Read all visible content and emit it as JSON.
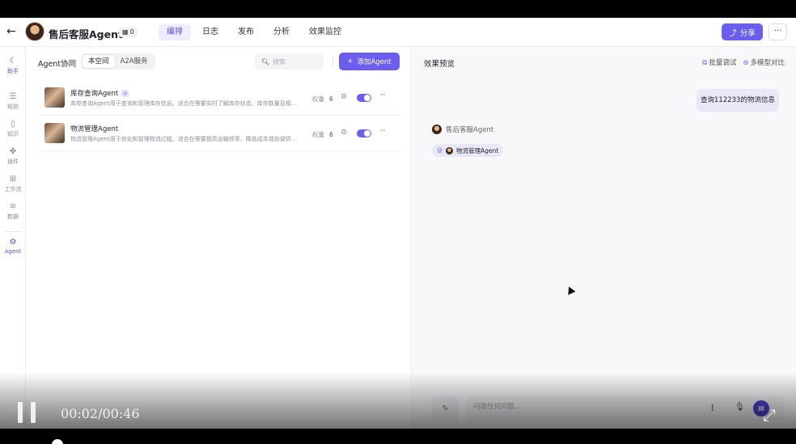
{
  "header": {
    "title": "售后客服Agent",
    "badge_count": "0",
    "tabs": [
      "编排",
      "日志",
      "发布",
      "分析",
      "效果监控"
    ],
    "active_tab": 0,
    "share_label": "分享",
    "more_label": "···"
  },
  "rail": [
    {
      "label": "助手",
      "icon": "assistant-icon"
    },
    {
      "label": "规则",
      "icon": "rules-icon"
    },
    {
      "label": "知识",
      "icon": "knowledge-icon"
    },
    {
      "label": "插件",
      "icon": "plugin-icon"
    },
    {
      "label": "工作流",
      "icon": "workflow-icon"
    },
    {
      "label": "数据",
      "icon": "database-icon"
    },
    {
      "label": "Agent",
      "icon": "agent-icon"
    }
  ],
  "middle": {
    "title": "Agent协同",
    "segments": [
      "本空间",
      "A2A服务"
    ],
    "search_placeholder": "搜索",
    "add_label": "添加Agent",
    "agents": [
      {
        "name": "库存查询Agent",
        "desc": "库存查询Agent用于查询和管理库存信息。适合在需要实时了解库存状态、库存数量及相...",
        "weight_label": "权重",
        "weight": "6",
        "enabled": true
      },
      {
        "name": "物流管理Agent",
        "desc": "物流管理Agent用于优化和管理物流过程。适合在需要提高运输效率、降低成本或协调供...",
        "weight_label": "权重",
        "weight": "6",
        "enabled": true
      }
    ]
  },
  "preview": {
    "title": "效果预览",
    "batch_debug": "批量调试",
    "multi_model": "多模型对比",
    "user_message": "查询112233的物流信息",
    "bot_name": "售后客服Agent",
    "mention_label": "物流管理Agent",
    "input_placeholder": "问我任何问题..."
  },
  "player": {
    "timecode": "00:02/00:46"
  },
  "colors": {
    "accent": "#6a5df0",
    "accent_light": "#e9e8f7"
  }
}
